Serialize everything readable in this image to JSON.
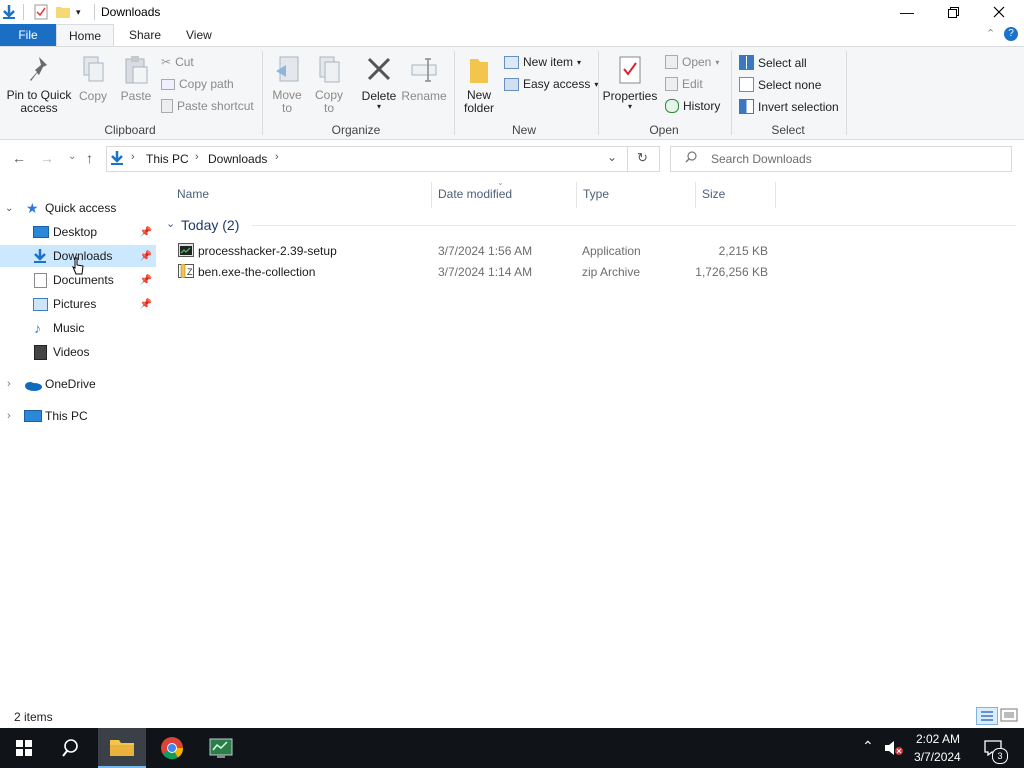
{
  "window": {
    "title": "Downloads"
  },
  "ribbon": {
    "tabs": [
      "File",
      "Home",
      "Share",
      "View"
    ],
    "clipboard": {
      "pin": "Pin to Quick access",
      "copy": "Copy",
      "paste": "Paste",
      "cut": "Cut",
      "copy_path": "Copy path",
      "paste_shortcut": "Paste shortcut",
      "group": "Clipboard"
    },
    "organize": {
      "move_to": "Move to",
      "copy_to": "Copy to",
      "delete": "Delete",
      "rename": "Rename",
      "group": "Organize"
    },
    "new": {
      "new_folder": "New folder",
      "new_item": "New item",
      "easy_access": "Easy access",
      "group": "New"
    },
    "open": {
      "properties": "Properties",
      "open": "Open",
      "edit": "Edit",
      "history": "History",
      "group": "Open"
    },
    "select": {
      "select_all": "Select all",
      "select_none": "Select none",
      "invert": "Invert selection",
      "group": "Select"
    }
  },
  "address": {
    "crumbs": [
      "This PC",
      "Downloads"
    ],
    "search_placeholder": "Search Downloads"
  },
  "nav": {
    "quick_access": "Quick access",
    "items": [
      "Desktop",
      "Downloads",
      "Documents",
      "Pictures",
      "Music",
      "Videos"
    ],
    "onedrive": "OneDrive",
    "this_pc": "This PC"
  },
  "list": {
    "columns": [
      "Name",
      "Date modified",
      "Type",
      "Size"
    ],
    "group": "Today (2)",
    "rows": [
      {
        "name": "processhacker-2.39-setup",
        "date": "3/7/2024 1:56 AM",
        "type": "Application",
        "size": "2,215 KB"
      },
      {
        "name": "ben.exe-the-collection",
        "date": "3/7/2024 1:14 AM",
        "type": "zip Archive",
        "size": "1,726,256 KB"
      }
    ]
  },
  "status": {
    "items": "2 items"
  },
  "taskbar": {
    "time": "2:02 AM",
    "date": "3/7/2024",
    "notifications": "3"
  },
  "colors": {
    "accent": "#1a6fc4",
    "selection": "#cce8ff",
    "taskbar": "#101418"
  }
}
